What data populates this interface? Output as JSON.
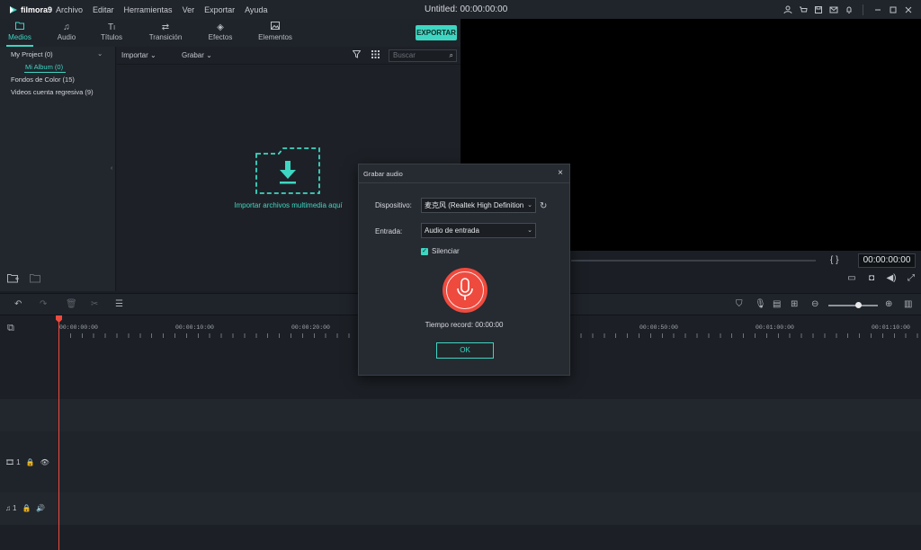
{
  "app": {
    "logo_text": "filmora9",
    "window_title": "Untitled:",
    "window_time": "00:00:00:00"
  },
  "menu": [
    "Archivo",
    "Editar",
    "Herramientas",
    "Ver",
    "Exportar",
    "Ayuda"
  ],
  "window_icons": [
    "user-icon",
    "cart-icon",
    "save-icon",
    "mail-icon",
    "bell-icon",
    "minimize-icon",
    "maximize-icon",
    "close-icon"
  ],
  "tabs": [
    {
      "label": "Medios",
      "icon": "folder-icon",
      "active": true
    },
    {
      "label": "Audio",
      "icon": "music-note-icon",
      "active": false
    },
    {
      "label": "Títulos",
      "icon": "text-icon",
      "active": false
    },
    {
      "label": "Transición",
      "icon": "transition-icon",
      "active": false
    },
    {
      "label": "Efectos",
      "icon": "effects-icon",
      "active": false
    },
    {
      "label": "Elementos",
      "icon": "image-icon",
      "active": false
    }
  ],
  "export_label": "EXPORTAR",
  "sidebar": {
    "items": [
      {
        "label": "My Project (0)"
      },
      {
        "label": "Mi Album (0)"
      },
      {
        "label": "Fondos de Color (15)"
      },
      {
        "label": "Videos cuenta regresiva (9)"
      }
    ]
  },
  "media_toolbar": {
    "import_label": "Importar",
    "record_label": "Grabar",
    "search_placeholder": "Buscar"
  },
  "media": {
    "import_text": "Importar archivos multimedia aquí"
  },
  "preview": {
    "timecode": "00:00:00:00",
    "brackets": "{ }"
  },
  "timeline": {
    "tick_labels": [
      "00:00:00:00",
      "00:00:10:00",
      "00:00:20:00",
      "00:00:50:00",
      "00:01:00:00",
      "00:01:10:00"
    ],
    "tracks": [
      {
        "name": "video-track",
        "index": "1"
      },
      {
        "name": "audio-track",
        "index": "1"
      }
    ]
  },
  "dialog": {
    "title": "Grabar audio",
    "device_label": "Dispositivo:",
    "device_value": "麦克风 (Realtek High Definition",
    "input_label": "Entrada:",
    "input_value": "Audio de entrada",
    "mute_label": "Silenciar",
    "mute_checked": true,
    "record_time_label": "Tiempo record: 00:00:00",
    "ok_label": "OK"
  },
  "colors": {
    "accent": "#3ed6c2",
    "record": "#ef4a3e",
    "background": "#1b1f25"
  }
}
